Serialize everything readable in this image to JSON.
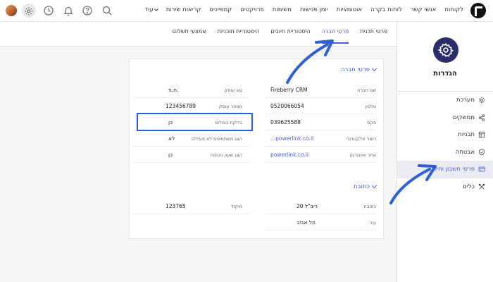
{
  "nav": {
    "items": [
      "לקוחות",
      "אנשי קשר",
      "לוחות בקרה",
      "אוטומציות",
      "יומן פגישות",
      "משימות",
      "פרויקטים",
      "קמפיינים",
      "קריאות שירות"
    ],
    "more": "עוד"
  },
  "topbar_icons": [
    "settings-icon",
    "clock-icon",
    "bell-icon",
    "help-icon",
    "search-icon"
  ],
  "sidebar": {
    "title": "הגדרות",
    "items": [
      {
        "label": "מערכת",
        "icon": "gear-icon"
      },
      {
        "label": "ממשקים",
        "icon": "share-icon"
      },
      {
        "label": "תבניות",
        "icon": "template-icon"
      },
      {
        "label": "אבטחה",
        "icon": "shield-icon"
      },
      {
        "label": "פרטי חשבון וחיוב",
        "icon": "card-icon"
      },
      {
        "label": "כלים",
        "icon": "tools-icon"
      }
    ],
    "active_index": 4
  },
  "tabs": [
    "פרטי תכנית",
    "פרטי חברה",
    "היסטוריית חיובים",
    "היסטוריית תוכניות",
    "אמצעי תשלום"
  ],
  "active_tab_index": 1,
  "company": {
    "section_title": "פרטי חברה",
    "right_rows": [
      {
        "label": "שם חברה",
        "value": "Fireberry CRM"
      },
      {
        "label": "טלפון",
        "value": "0520066054"
      },
      {
        "label": "פקס",
        "value": "039625588"
      },
      {
        "label": "דואר אלקטרוני",
        "value": "...powerlink.co.il"
      },
      {
        "label": "אתר אינטרנט",
        "value": "powerlink.co.il"
      }
    ],
    "left_rows": [
      {
        "label": "סוג עוסק",
        "value": "ח.פ."
      },
      {
        "label": "מספר עוסק",
        "value": "123456789"
      },
      {
        "label": "בדיקת כפולים",
        "value": "כן"
      },
      {
        "label": "הצג משתמשים לא פעילים",
        "value": "לא"
      },
      {
        "label": "הצג שעון נוכחות",
        "value": "כן"
      }
    ]
  },
  "address": {
    "section_title": "כתובת",
    "right_rows": [
      {
        "label": "כתובת",
        "value": "ריב\"ל 20"
      },
      {
        "label": "עיר",
        "value": "תל אביב"
      }
    ],
    "left_rows": [
      {
        "label": "מיקוד",
        "value": "123765"
      }
    ]
  },
  "colors": {
    "accent": "#4a5fd0",
    "annotation": "#2f5fd6",
    "gear_bg": "#2a2d6b"
  }
}
